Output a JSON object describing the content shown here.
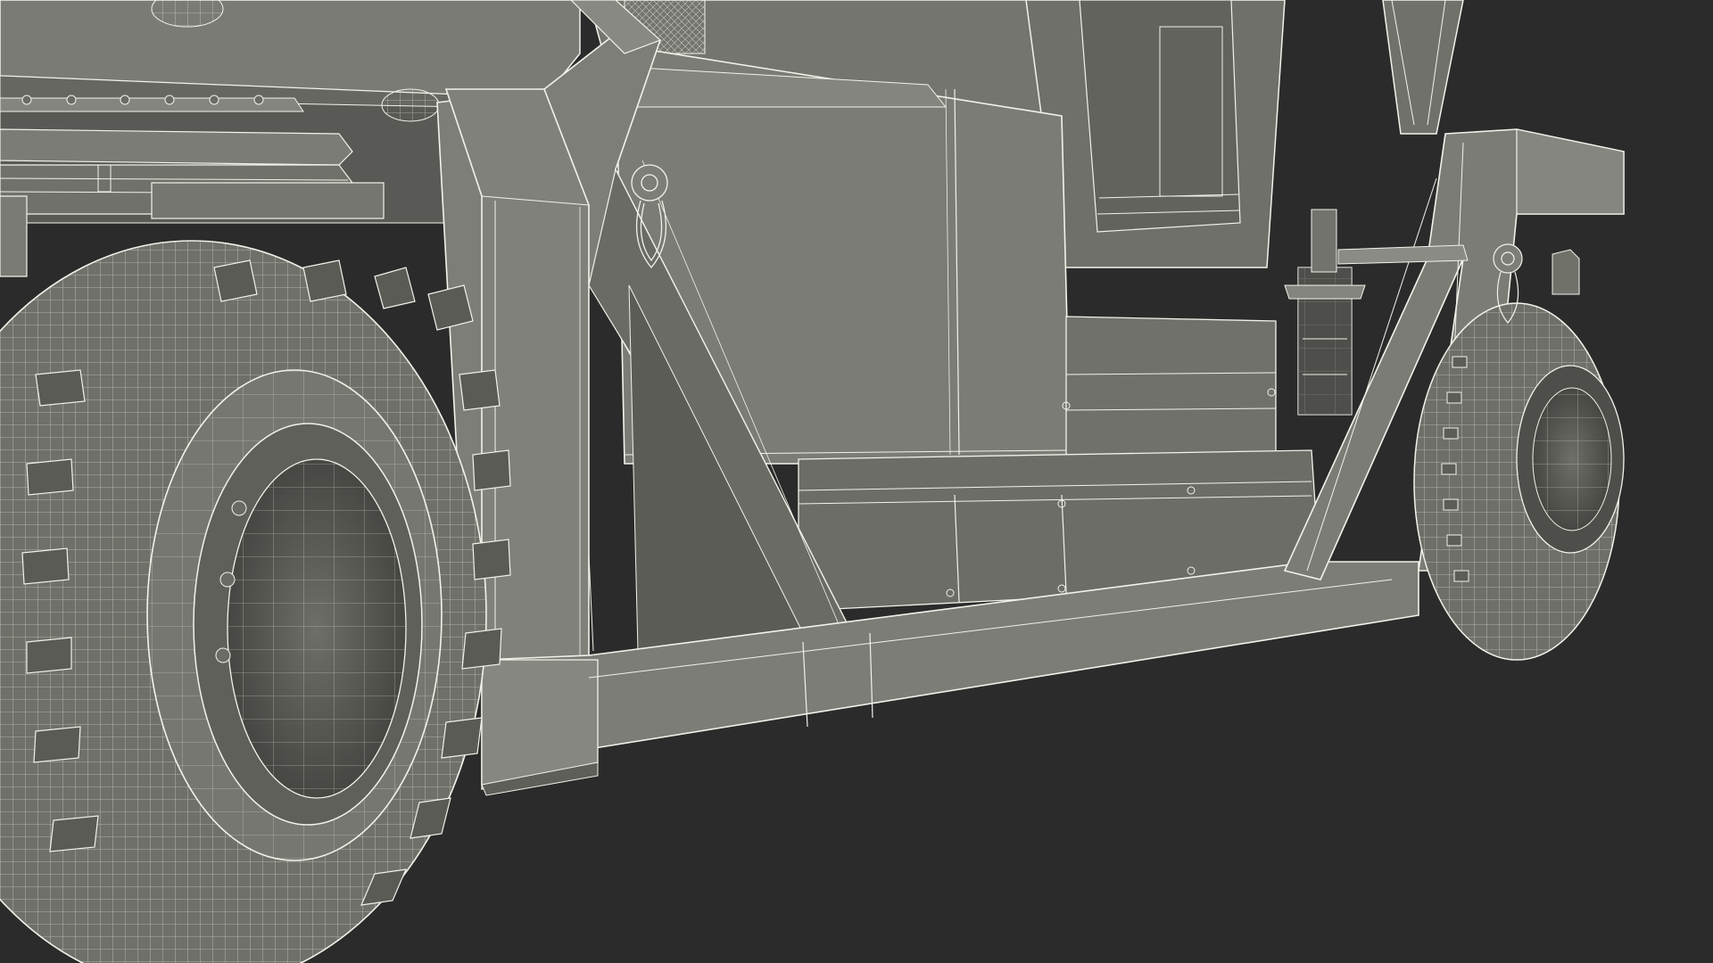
{
  "scene": {
    "subject": "",
    "colors": {
      "background": "#2b2b2b",
      "surface": "#76776f",
      "surface_light": "#868780",
      "surface_dark": "#5f605a",
      "tire_dark": "#4e4f4a",
      "wire": "#f2f2ea"
    }
  }
}
